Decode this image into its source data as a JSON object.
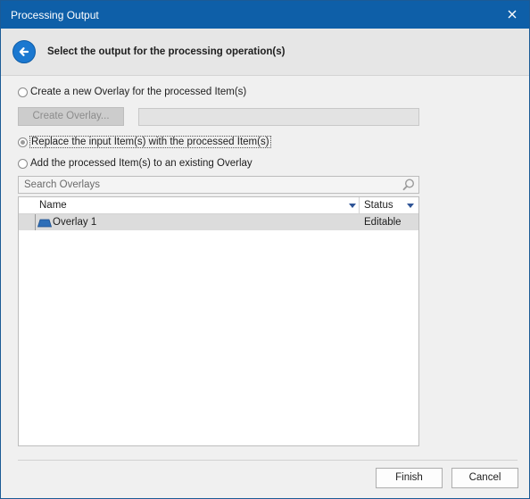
{
  "window": {
    "title": "Processing Output"
  },
  "header": {
    "heading": "Select the output for the processing operation(s)"
  },
  "options": {
    "create_new": "Create a new Overlay for the processed Item(s)",
    "create_overlay_button": "Create Overlay...",
    "replace_input": "Replace the input Item(s) with the processed Item(s)",
    "add_existing": "Add the processed Item(s) to an existing Overlay",
    "selected": "replace_input"
  },
  "search": {
    "placeholder": "Search Overlays",
    "value": ""
  },
  "grid": {
    "columns": [
      "Name",
      "Status"
    ],
    "rows": [
      {
        "name": "Overlay 1",
        "status": "Editable",
        "icon": "overlay-icon"
      }
    ]
  },
  "footer": {
    "finish_label": "Finish",
    "cancel_label": "Cancel"
  },
  "colors": {
    "titlebar": "#0e5fa8",
    "accent": "#1b78d0",
    "row_selected": "#dcdcdc"
  }
}
